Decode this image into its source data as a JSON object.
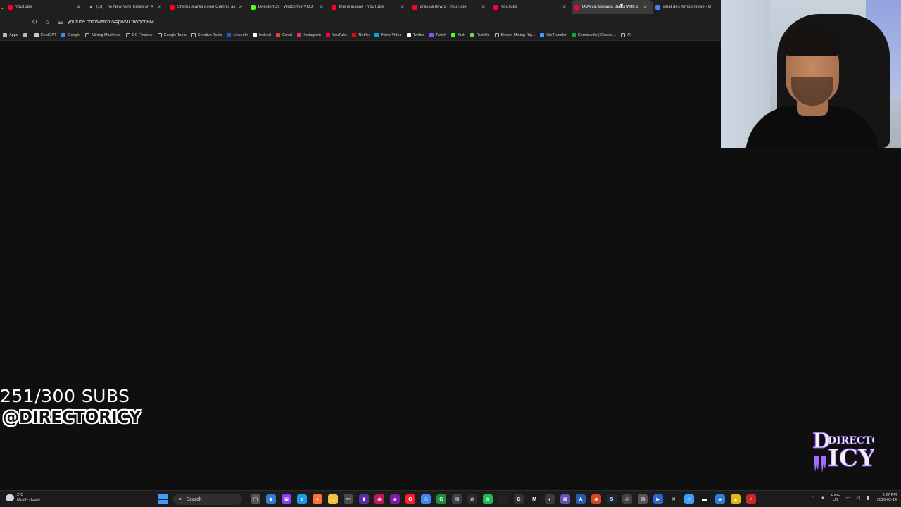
{
  "browser": {
    "tabs": [
      {
        "title": "YouTube",
        "favicon": "youtube-icon",
        "color": "#ff0033",
        "active": false
      },
      {
        "title": "(13) The New York Times on X",
        "favicon": "x-icon",
        "color": "#ffffff",
        "active": false
      },
      {
        "title": "Shams stares down Giannis as",
        "favicon": "youtube-icon",
        "color": "#ff0033",
        "active": false
      },
      {
        "title": "DirectorICY - Watch the VOD",
        "favicon": "kick-icon",
        "color": "#53fc18",
        "active": false
      },
      {
        "title": "this is insane - YouTube",
        "favicon": "youtube-icon",
        "color": "#ff0033",
        "active": false
      },
      {
        "title": "dracula flow 3 - YouTube",
        "favicon": "youtube-icon",
        "color": "#ff0033",
        "active": false
      },
      {
        "title": "YouTube",
        "favicon": "youtube-icon",
        "color": "#ff0033",
        "active": false
      },
      {
        "title": "USA vs. Canada Starts With 3",
        "favicon": "youtube-icon",
        "color": "#ff0033",
        "active": true
      },
      {
        "title": "what des himbo mean - G",
        "favicon": "google-icon",
        "color": "#4285f4",
        "active": false
      }
    ],
    "url": "youtube.com/watch?v=pwMLbWqc6BM",
    "bookmarks": [
      {
        "label": "Apps",
        "icon": "apps-grid-icon",
        "color": "#bbbbbb"
      },
      {
        "label": "",
        "icon": "tab-groups-icon",
        "color": "#bbbbbb"
      },
      {
        "label": "ChatGPT",
        "icon": "chatgpt-icon",
        "color": "#cccccc"
      },
      {
        "label": "Google",
        "icon": "google-icon",
        "color": "#4285f4"
      },
      {
        "label": "Mining Machines",
        "icon": "folder-icon",
        "color": "folder"
      },
      {
        "label": "DC Finance",
        "icon": "folder-icon",
        "color": "folder"
      },
      {
        "label": "Google Tools",
        "icon": "folder-icon",
        "color": "folder"
      },
      {
        "label": "Creative Tools",
        "icon": "folder-icon",
        "color": "folder"
      },
      {
        "label": "LinkedIn",
        "icon": "linkedin-icon",
        "color": "#0a66c2"
      },
      {
        "label": "Indeed",
        "icon": "indeed-icon",
        "color": "#ffffff"
      },
      {
        "label": "Gmail",
        "icon": "gmail-icon",
        "color": "#ea4335"
      },
      {
        "label": "Instagram",
        "icon": "instagram-icon",
        "color": "#e1306c"
      },
      {
        "label": "YouTube",
        "icon": "youtube-icon",
        "color": "#ff0033"
      },
      {
        "label": "Netflix",
        "icon": "netflix-icon",
        "color": "#e50914"
      },
      {
        "label": "Prime Video",
        "icon": "prime-video-icon",
        "color": "#00a8e1"
      },
      {
        "label": "Twitter",
        "icon": "x-icon",
        "color": "#ffffff"
      },
      {
        "label": "Twitch",
        "icon": "twitch-icon",
        "color": "#9146ff"
      },
      {
        "label": "Kick",
        "icon": "kick-icon",
        "color": "#53fc18"
      },
      {
        "label": "Rumble",
        "icon": "rumble-icon",
        "color": "#85c742"
      },
      {
        "label": "Bitcoin Mining Rig...",
        "icon": "folder-icon",
        "color": "folder"
      },
      {
        "label": "WeTransfer",
        "icon": "wetransfer-icon",
        "color": "#409fff"
      },
      {
        "label": "Community | Glassd...",
        "icon": "glassdoor-icon",
        "color": "#0caa41"
      },
      {
        "label": "Al",
        "icon": "folder-icon",
        "color": "folder"
      }
    ]
  },
  "overlay": {
    "subs": "251/300 SUBS",
    "handle": "@DIRECTORICY",
    "logo_top": "DIRECTOR",
    "logo_bottom": "ICY",
    "logo_color": "#a56cff"
  },
  "taskbar": {
    "weather_temp": "2°C",
    "weather_desc": "Mostly cloudy",
    "search_placeholder": "Search",
    "apps": [
      {
        "name": "task-view-icon",
        "color": "#555555",
        "glyph": "▢"
      },
      {
        "name": "copilot-icon",
        "color": "#2d7dd2",
        "glyph": "◆"
      },
      {
        "name": "app-icon",
        "color": "#8a3ffc",
        "glyph": "▣"
      },
      {
        "name": "edge-icon",
        "color": "#1b9de2",
        "glyph": "e"
      },
      {
        "name": "firefox-icon",
        "color": "#ff7139",
        "glyph": "●"
      },
      {
        "name": "file-explorer-icon",
        "color": "#f3c13a",
        "glyph": "▭"
      },
      {
        "name": "snipping-icon",
        "color": "#4a4a4a",
        "glyph": "✂"
      },
      {
        "name": "app-icon",
        "color": "#5a2ea6",
        "glyph": "▮"
      },
      {
        "name": "app-icon",
        "color": "#c2185b",
        "glyph": "◉"
      },
      {
        "name": "app-icon",
        "color": "#7b1fa2",
        "glyph": "◈"
      },
      {
        "name": "opera-icon",
        "color": "#ff1b2d",
        "glyph": "O"
      },
      {
        "name": "chrome-icon",
        "color": "#4285f4",
        "glyph": "◎"
      },
      {
        "name": "app-icon",
        "color": "#1e8e3e",
        "glyph": "G"
      },
      {
        "name": "app-icon",
        "color": "#3c4043",
        "glyph": "▤"
      },
      {
        "name": "obs-icon",
        "color": "#2b2b2b",
        "glyph": "◍"
      },
      {
        "name": "spotify-icon",
        "color": "#1db954",
        "glyph": "≋"
      },
      {
        "name": "app-icon",
        "color": "#222222",
        "glyph": "~"
      },
      {
        "name": "app-icon",
        "color": "#333333",
        "glyph": "G"
      },
      {
        "name": "app-icon",
        "color": "#1a1a1a",
        "glyph": "M"
      },
      {
        "name": "app-icon",
        "color": "#3b3b3b",
        "glyph": "◐"
      },
      {
        "name": "app-icon",
        "color": "#6a4fb3",
        "glyph": "▦"
      },
      {
        "name": "app-icon",
        "color": "#2a5db0",
        "glyph": "A"
      },
      {
        "name": "app-icon",
        "color": "#d4471e",
        "glyph": "◉"
      },
      {
        "name": "steam-icon",
        "color": "#1b2838",
        "glyph": "S"
      },
      {
        "name": "app-icon",
        "color": "#444444",
        "glyph": "◎"
      },
      {
        "name": "app-icon",
        "color": "#555555",
        "glyph": "▤"
      },
      {
        "name": "app-icon",
        "color": "#2f62d1",
        "glyph": "▶"
      },
      {
        "name": "capcut-icon",
        "color": "#1a1a1a",
        "glyph": "✕"
      },
      {
        "name": "app-icon",
        "color": "#3aa0ff",
        "glyph": "◇"
      },
      {
        "name": "app-icon",
        "color": "#1a1a1a",
        "glyph": "▬"
      },
      {
        "name": "app-icon",
        "color": "#2d7dd2",
        "glyph": "▰"
      },
      {
        "name": "app-icon",
        "color": "#e2b714",
        "glyph": "▲"
      },
      {
        "name": "app-icon",
        "color": "#c62828",
        "glyph": "⁄"
      }
    ],
    "lang_top": "ENG",
    "lang_bottom": "US",
    "time": "9:27 PM",
    "date": "2026-02-14"
  }
}
